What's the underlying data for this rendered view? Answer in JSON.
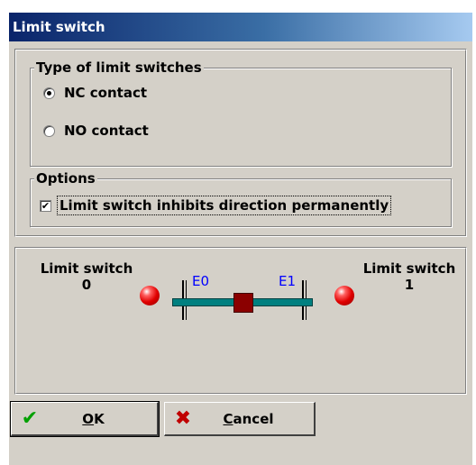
{
  "window": {
    "title": "Limit switch"
  },
  "type_group": {
    "legend": "Type of limit switches",
    "options": [
      {
        "label": "NC contact",
        "checked": true
      },
      {
        "label": "NO contact",
        "checked": false
      }
    ]
  },
  "options_group": {
    "legend": "Options",
    "checkbox_label": "Limit switch inhibits direction permanently",
    "checked": true
  },
  "diagram": {
    "left_label": "Limit switch",
    "left_number": "0",
    "right_label": "Limit switch",
    "right_number": "1",
    "e0": "E0",
    "e1": "E1",
    "led_color": "#e00000",
    "rail_color": "#008080",
    "carriage_color": "#8b0000"
  },
  "buttons": {
    "ok": {
      "icon": "check-icon",
      "hotkey": "O",
      "rest": "K"
    },
    "cancel": {
      "icon": "x-icon",
      "hotkey": "C",
      "rest": "ancel"
    }
  }
}
